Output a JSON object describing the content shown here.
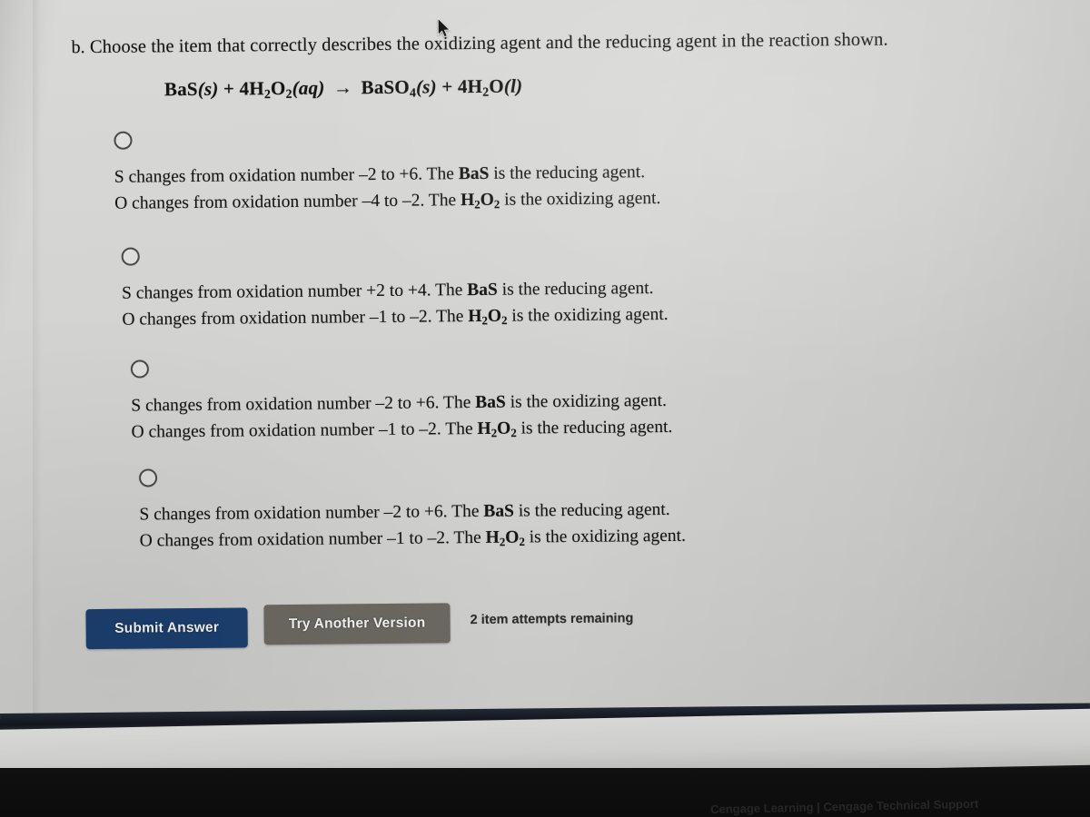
{
  "question": {
    "label": "b.",
    "text": "Choose the item that correctly describes the oxidizing agent and the reducing agent in the reaction shown."
  },
  "equation": {
    "reactant_1": "BaS",
    "reactant_1_state": "(s)",
    "plus_1": "+",
    "reactant_2_coeff": "4H",
    "reactant_2_sub_1": "2",
    "reactant_2_mid": "O",
    "reactant_2_sub_2": "2",
    "reactant_2_state": "(aq)",
    "arrow": "→",
    "product_1": "BaSO",
    "product_1_sub": "4",
    "product_1_state": "(s)",
    "plus_2": "+",
    "product_2_coeff": "4H",
    "product_2_sub": "2",
    "product_2_mid": "O",
    "product_2_state": "(l)",
    "plain_text": "BaS(s) + 4H2O2(aq) -> BaSO4(s) + 4H2O(l)"
  },
  "options": [
    {
      "id": "option-a",
      "selected": false,
      "line1_pre": "S changes from oxidation number –2 to +6. The ",
      "line1_formula": "BaS",
      "line1_post": " is the reducing agent.",
      "line2_pre": "O changes from oxidation number –4 to –2. The ",
      "line2_formula_h": "H",
      "line2_formula_sub1": "2",
      "line2_formula_o": "O",
      "line2_formula_sub2": "2",
      "line2_post": " is the oxidizing agent."
    },
    {
      "id": "option-b",
      "selected": false,
      "line1_pre": "S changes from oxidation number +2 to +4. The ",
      "line1_formula": "BaS",
      "line1_post": " is the reducing agent.",
      "line2_pre": "O changes from oxidation number –1 to –2. The ",
      "line2_formula_h": "H",
      "line2_formula_sub1": "2",
      "line2_formula_o": "O",
      "line2_formula_sub2": "2",
      "line2_post": " is the oxidizing agent."
    },
    {
      "id": "option-c",
      "selected": false,
      "line1_pre": "S changes from oxidation number –2 to +6. The ",
      "line1_formula": "BaS",
      "line1_post": " is the oxidizing agent.",
      "line2_pre": "O changes from oxidation number –1 to –2. The ",
      "line2_formula_h": "H",
      "line2_formula_sub1": "2",
      "line2_formula_o": "O",
      "line2_formula_sub2": "2",
      "line2_post": " is the reducing agent."
    },
    {
      "id": "option-d",
      "selected": false,
      "line1_pre": "S changes from oxidation number –2 to +6. The ",
      "line1_formula": "BaS",
      "line1_post": " is the reducing agent.",
      "line2_pre": "O changes from oxidation number –1 to –2. The ",
      "line2_formula_h": "H",
      "line2_formula_sub1": "2",
      "line2_formula_o": "O",
      "line2_formula_sub2": "2",
      "line2_post": " is the oxidizing agent."
    }
  ],
  "actions": {
    "submit_label": "Submit Answer",
    "try_another_label": "Try Another Version",
    "attempts_text": "2 item attempts remaining"
  },
  "footer": {
    "text": "Cengage Learning | Cengage Technical Support"
  },
  "colors": {
    "submit_button": "#1c3f6e",
    "try_another_button": "#6b6862",
    "page_background": "#d4d4d2",
    "text": "#151515"
  }
}
